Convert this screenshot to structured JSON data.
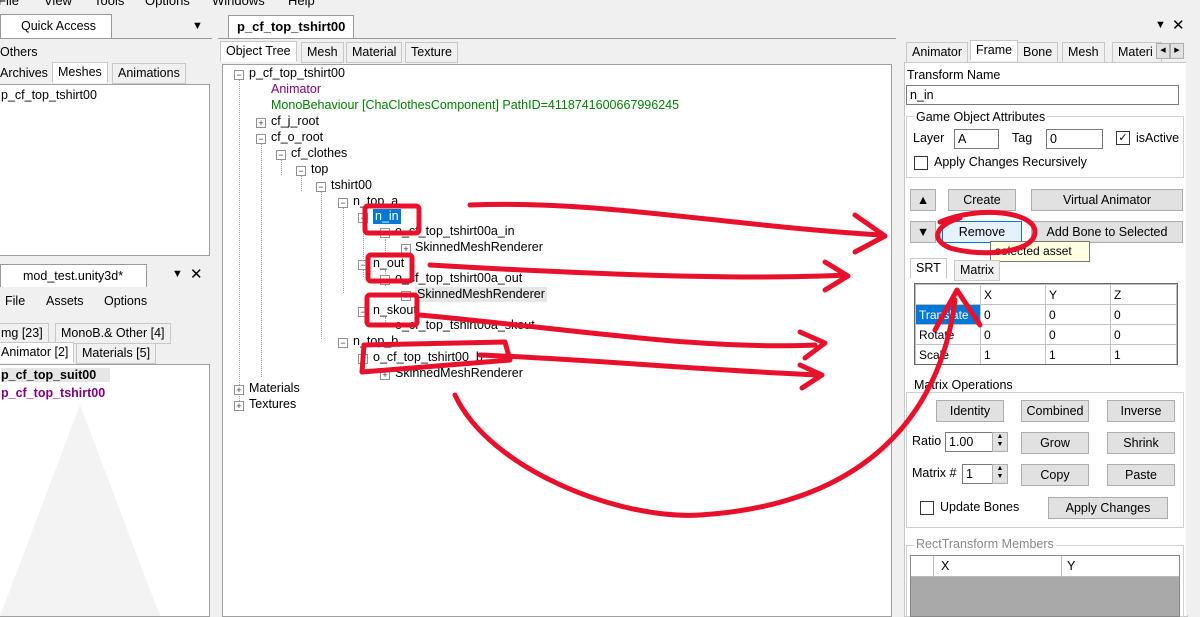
{
  "menubar": [
    "File",
    "View",
    "Tools",
    "Options",
    "Windows",
    "Help"
  ],
  "quick_access": {
    "title": "Quick Access",
    "items": [
      "Others",
      "Archives"
    ],
    "tabs": [
      "Meshes",
      "Animations"
    ],
    "list": [
      "p_cf_top_tshirt00"
    ]
  },
  "mod_panel": {
    "title": "mod_test.unity3d*",
    "menu": [
      "File",
      "Assets",
      "Options"
    ],
    "tabs_row1": [
      "mg [23]",
      "MonoB.& Other [4]"
    ],
    "tabs_row2": [
      "Animator [2]",
      "Materials [5]"
    ],
    "list": [
      "p_cf_top_suit00",
      "p_cf_top_tshirt00"
    ]
  },
  "document": {
    "tab_title": "p_cf_top_tshirt00",
    "tabs": [
      "Object Tree",
      "Mesh",
      "Material",
      "Texture"
    ],
    "tree": {
      "root": "p_cf_top_tshirt00",
      "animator": "Animator",
      "mono": "MonoBehaviour [ChaClothesComponent] PathID=4118741600667996245",
      "cf_j_root": "cf_j_root",
      "cf_o_root": "cf_o_root",
      "cf_clothes": "cf_clothes",
      "top": "top",
      "tshirt00": "tshirt00",
      "n_top_a": "n_top_a",
      "n_in": "n_in",
      "o_in": "o_cf_top_tshirt00a_in",
      "smr1": "SkinnedMeshRenderer",
      "n_out": "n_out",
      "o_out": "o_cf_top_tshirt00a_out",
      "smr2": "SkinnedMeshRenderer",
      "n_skout": "n_skout",
      "o_skout": "o_cf_top_tshirt00a_skout",
      "n_top_b": "n_top_b",
      "o_b": "o_cf_top_tshirt00_b",
      "smr3": "SkinnedMeshRenderer",
      "materials": "Materials",
      "textures": "Textures"
    }
  },
  "right_panel": {
    "tabs": [
      "Animator",
      "Frame",
      "Bone",
      "Mesh",
      "Materi"
    ],
    "transform_name_label": "Transform Name",
    "transform_name_value": "n_in",
    "goa_label": "Game Object Attributes",
    "layer_label": "Layer",
    "layer_value": "A",
    "tag_label": "Tag",
    "tag_value": "0",
    "is_active_label": "isActive",
    "is_active_mark": "✓",
    "apply_recursive_label": "Apply Changes Recursively",
    "up_glyph": "▲",
    "down_glyph": "▼",
    "create_btn": "Create",
    "virtual_animator_btn": "Virtual Animator",
    "remove_btn": "Remove",
    "add_bone_btn": "Add Bone to Selected",
    "tooltip": "selected asset",
    "srt_tabs": [
      "SRT",
      "Matrix"
    ],
    "grid_headers": [
      "",
      "X",
      "Y",
      "Z"
    ],
    "grid_rows": [
      [
        "Translate",
        "0",
        "0",
        "0"
      ],
      [
        "Rotate",
        "0",
        "0",
        "0"
      ],
      [
        "Scale",
        "1",
        "1",
        "1"
      ]
    ],
    "matrix_ops_label": "Matrix Operations",
    "identity_btn": "Identity",
    "combined_btn": "Combined",
    "inverse_btn": "Inverse",
    "ratio_label": "Ratio",
    "ratio_value": "1.00",
    "grow_btn": "Grow",
    "shrink_btn": "Shrink",
    "matrix_num_label": "Matrix #",
    "matrix_num_value": "1",
    "copy_btn": "Copy",
    "paste_btn": "Paste",
    "update_bones_label": "Update Bones",
    "apply_changes_btn": "Apply Changes",
    "rect_label": "RectTransform Members",
    "rect_headers": [
      "X",
      "Y"
    ]
  },
  "annotation_color": "#e8102a"
}
